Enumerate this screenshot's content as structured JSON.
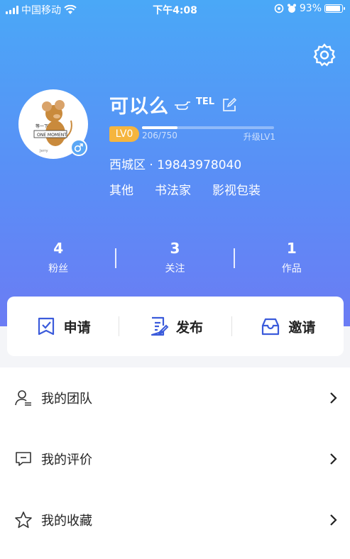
{
  "status_bar": {
    "carrier": "中国移动",
    "time": "下午4:08",
    "battery": "93%",
    "battery_level": 0.93
  },
  "profile": {
    "username": "可以么",
    "tel_tag": "TEL",
    "level": "LV0",
    "xp": "206/750",
    "xp_progress": 0.27,
    "next_level": "升级LV1",
    "location": "西城区 · 19843978040",
    "tags": [
      "其他",
      "书法家",
      "影视包装"
    ],
    "gender": "male"
  },
  "stats": [
    {
      "value": "4",
      "label": "粉丝"
    },
    {
      "value": "3",
      "label": "关注"
    },
    {
      "value": "1",
      "label": "作品"
    }
  ],
  "actions": [
    {
      "label": "申请",
      "icon": "apply-icon"
    },
    {
      "label": "发布",
      "icon": "publish-icon"
    },
    {
      "label": "邀请",
      "icon": "invite-icon"
    }
  ],
  "menu": [
    {
      "label": "我的团队",
      "icon": "team-icon"
    },
    {
      "label": "我的评价",
      "icon": "comment-icon"
    },
    {
      "label": "我的收藏",
      "icon": "star-icon"
    }
  ],
  "colors": {
    "accent": "#3b5bdb",
    "level_badge": "#f5b53e",
    "gradient_top": "#4aa8f7",
    "gradient_bottom": "#6b7cf4"
  }
}
